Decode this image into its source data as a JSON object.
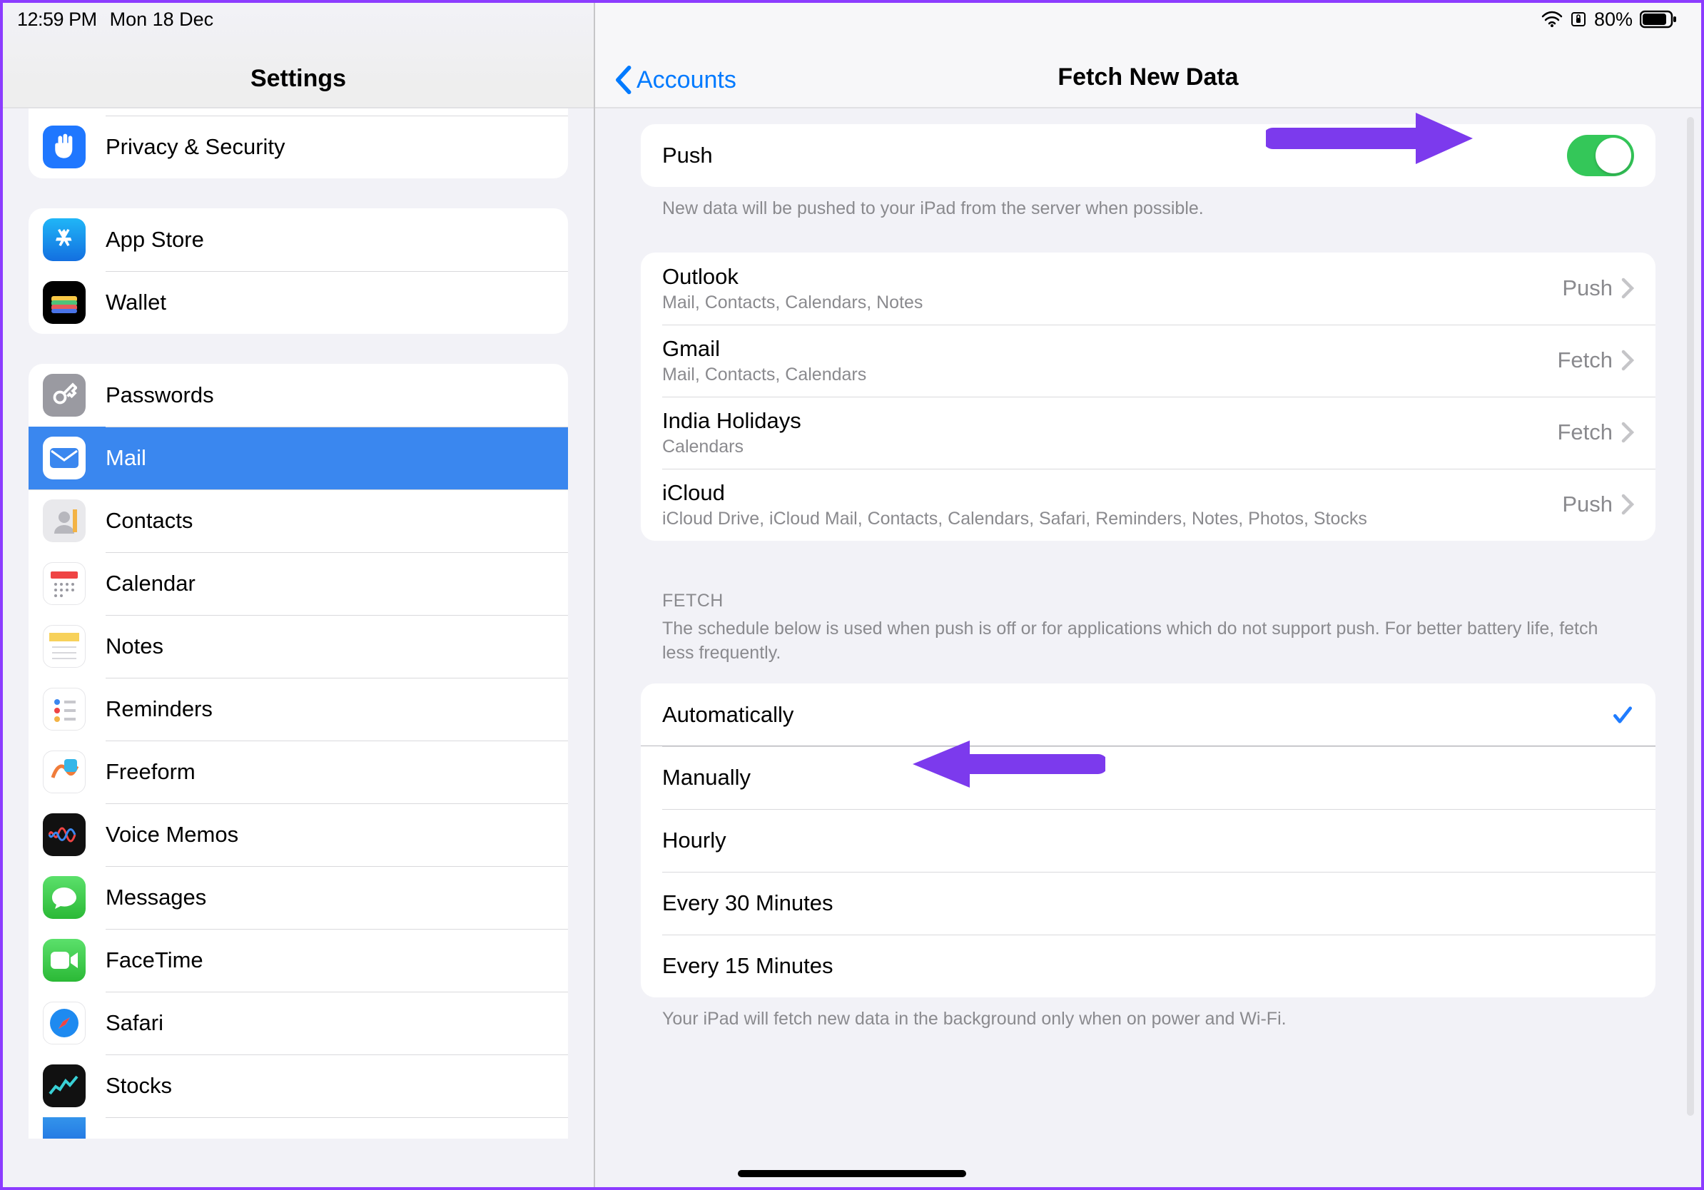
{
  "statusbar": {
    "time": "12:59 PM",
    "date": "Mon 18 Dec",
    "battery_pct": "80%"
  },
  "sidebar": {
    "title": "Settings",
    "group_a_partial": [
      {
        "label": "Privacy & Security",
        "icon": "hand",
        "bg": "#1f77ff"
      }
    ],
    "group_b": [
      {
        "label": "App Store",
        "icon": "appstore",
        "bg": "#1e8af0"
      },
      {
        "label": "Wallet",
        "icon": "wallet",
        "bg": "#000"
      }
    ],
    "group_c": [
      {
        "label": "Passwords",
        "icon": "key",
        "bg": "#9a9aa1"
      },
      {
        "label": "Mail",
        "icon": "mail",
        "bg": "#2e7cf6",
        "selected": true
      },
      {
        "label": "Contacts",
        "icon": "contacts",
        "bg": "#d4d4d8"
      },
      {
        "label": "Calendar",
        "icon": "calendar",
        "bg": "#ffffff"
      },
      {
        "label": "Notes",
        "icon": "notes",
        "bg": "#ffffff"
      },
      {
        "label": "Reminders",
        "icon": "reminders",
        "bg": "#ffffff"
      },
      {
        "label": "Freeform",
        "icon": "freeform",
        "bg": "#ffffff"
      },
      {
        "label": "Voice Memos",
        "icon": "voicememos",
        "bg": "#111"
      },
      {
        "label": "Messages",
        "icon": "messages",
        "bg": "#3ccc46"
      },
      {
        "label": "FaceTime",
        "icon": "facetime",
        "bg": "#3ccc46"
      },
      {
        "label": "Safari",
        "icon": "safari",
        "bg": "#ffffff"
      },
      {
        "label": "Stocks",
        "icon": "stocks",
        "bg": "#111"
      }
    ]
  },
  "detail": {
    "back_label": "Accounts",
    "title": "Fetch New Data",
    "push_row_label": "Push",
    "push_enabled": true,
    "push_caption": "New data will be pushed to your iPad from the server when possible.",
    "accounts": [
      {
        "name": "Outlook",
        "sub": "Mail, Contacts, Calendars, Notes",
        "mode": "Push"
      },
      {
        "name": "Gmail",
        "sub": "Mail, Contacts, Calendars",
        "mode": "Fetch"
      },
      {
        "name": "India Holidays",
        "sub": "Calendars",
        "mode": "Fetch"
      },
      {
        "name": "iCloud",
        "sub": "iCloud Drive, iCloud Mail, Contacts, Calendars, Safari, Reminders, Notes, Photos, Stocks",
        "mode": "Push"
      }
    ],
    "fetch_section_title": "FETCH",
    "fetch_section_caption": "The schedule below is used when push is off or for applications which do not support push. For better battery life, fetch less frequently.",
    "fetch_options": [
      {
        "label": "Automatically",
        "checked": true
      },
      {
        "label": "Manually",
        "checked": false
      },
      {
        "label": "Hourly",
        "checked": false
      },
      {
        "label": "Every 30 Minutes",
        "checked": false
      },
      {
        "label": "Every 15 Minutes",
        "checked": false
      }
    ],
    "fetch_footer": "Your iPad will fetch new data in the background only when on power and Wi-Fi."
  }
}
